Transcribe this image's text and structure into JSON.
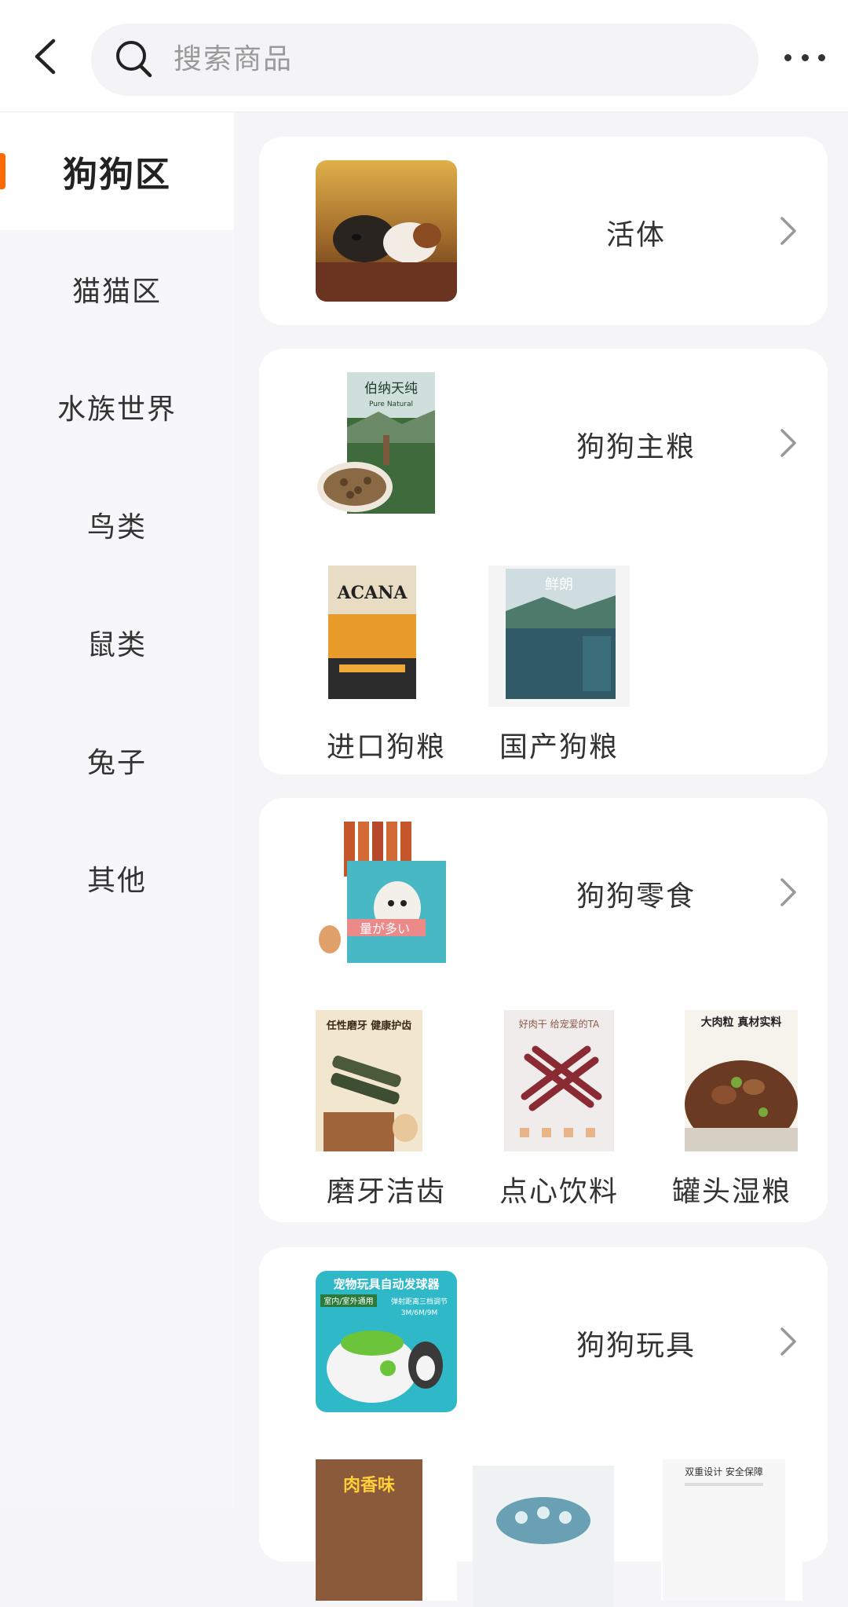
{
  "search": {
    "placeholder": "搜索商品"
  },
  "sidebar": {
    "items": [
      {
        "label": "狗狗区",
        "active": true
      },
      {
        "label": "猫猫区"
      },
      {
        "label": "水族世界"
      },
      {
        "label": "鸟类"
      },
      {
        "label": "鼠类"
      },
      {
        "label": "兔子"
      },
      {
        "label": "其他"
      }
    ]
  },
  "sections": [
    {
      "title": "活体",
      "thumb_icon": "puppies-photo"
    },
    {
      "title": "狗狗主粮",
      "thumb_icon": "dog-food-bag-photo",
      "thumb_text": {
        "brand_cn": "伯纳天纯",
        "brand_en": "Pure Natural"
      },
      "subs": [
        {
          "label": "进口狗粮",
          "img_text": "ACANA"
        },
        {
          "label": "国产狗粮",
          "img_text": "鲜朗"
        }
      ]
    },
    {
      "title": "狗狗零食",
      "thumb_icon": "dog-snack-bag-photo",
      "thumb_text": "量が多い",
      "subs": [
        {
          "label": "磨牙洁齿",
          "img_text": "任性磨牙 健康护齿"
        },
        {
          "label": "点心饮料",
          "img_text": "好肉干 给宠爱的TA"
        },
        {
          "label": "罐头湿粮",
          "img_text": "大肉粒 真材实料"
        }
      ]
    },
    {
      "title": "狗狗玩具",
      "thumb_icon": "ball-launcher-photo",
      "thumb_text": {
        "headline": "宠物玩具自动发球器",
        "tag": "室内/室外通用",
        "note": "弹射距离三档调节",
        "range": "3M/6M/9M"
      },
      "subs": [
        {
          "img_text": "肉香味"
        },
        {
          "img_text": ""
        },
        {
          "img_text": "双重设计 安全保障"
        }
      ]
    }
  ],
  "colors": {
    "accent": "#ff6a00",
    "page_bg": "#f5f5f7",
    "card_bg": "#ffffff"
  }
}
